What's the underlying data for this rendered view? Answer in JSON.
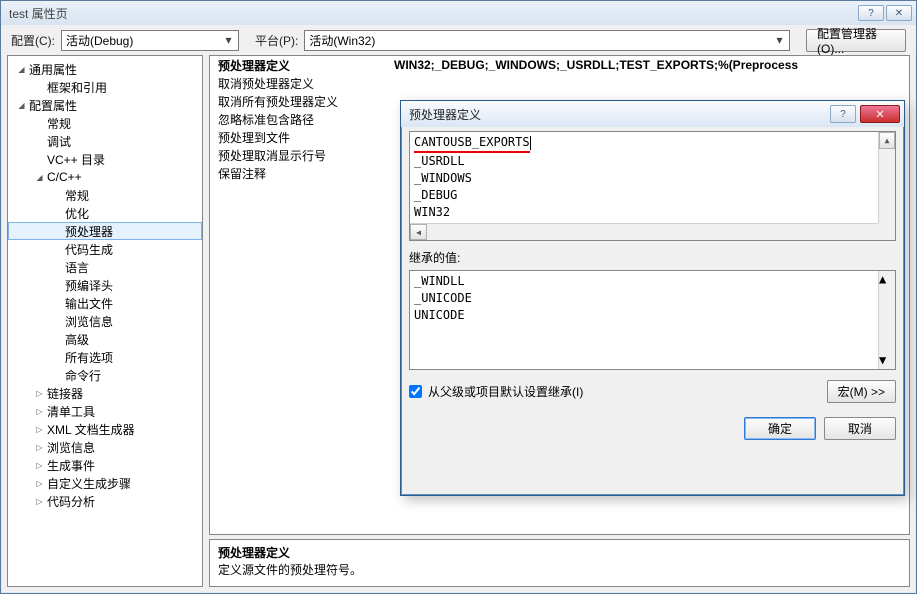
{
  "window": {
    "title": "test 属性页"
  },
  "toolbar": {
    "config_label": "配置(C):",
    "config_value": "活动(Debug)",
    "platform_label": "平台(P):",
    "platform_value": "活动(Win32)",
    "config_mgr_label": "配置管理器(O)..."
  },
  "tree": [
    {
      "indent": 0,
      "twisty": "◢",
      "label": "通用属性"
    },
    {
      "indent": 1,
      "twisty": "",
      "label": "框架和引用"
    },
    {
      "indent": 0,
      "twisty": "◢",
      "label": "配置属性"
    },
    {
      "indent": 1,
      "twisty": "",
      "label": "常规"
    },
    {
      "indent": 1,
      "twisty": "",
      "label": "调试"
    },
    {
      "indent": 1,
      "twisty": "",
      "label": "VC++ 目录"
    },
    {
      "indent": 1,
      "twisty": "◢",
      "label": "C/C++"
    },
    {
      "indent": 2,
      "twisty": "",
      "label": "常规"
    },
    {
      "indent": 2,
      "twisty": "",
      "label": "优化"
    },
    {
      "indent": 2,
      "twisty": "",
      "label": "预处理器",
      "selected": true
    },
    {
      "indent": 2,
      "twisty": "",
      "label": "代码生成"
    },
    {
      "indent": 2,
      "twisty": "",
      "label": "语言"
    },
    {
      "indent": 2,
      "twisty": "",
      "label": "预编译头"
    },
    {
      "indent": 2,
      "twisty": "",
      "label": "输出文件"
    },
    {
      "indent": 2,
      "twisty": "",
      "label": "浏览信息"
    },
    {
      "indent": 2,
      "twisty": "",
      "label": "高级"
    },
    {
      "indent": 2,
      "twisty": "",
      "label": "所有选项"
    },
    {
      "indent": 2,
      "twisty": "",
      "label": "命令行"
    },
    {
      "indent": 1,
      "twisty": "▷",
      "label": "链接器"
    },
    {
      "indent": 1,
      "twisty": "▷",
      "label": "清单工具"
    },
    {
      "indent": 1,
      "twisty": "▷",
      "label": "XML 文档生成器"
    },
    {
      "indent": 1,
      "twisty": "▷",
      "label": "浏览信息"
    },
    {
      "indent": 1,
      "twisty": "▷",
      "label": "生成事件"
    },
    {
      "indent": 1,
      "twisty": "▷",
      "label": "自定义生成步骤"
    },
    {
      "indent": 1,
      "twisty": "▷",
      "label": "代码分析"
    }
  ],
  "props": {
    "rows": [
      {
        "label": "预处理器定义",
        "value": "WIN32;_DEBUG;_WINDOWS;_USRDLL;TEST_EXPORTS;%(Preprocess",
        "bold": true
      },
      {
        "label": "取消预处理器定义",
        "value": ""
      },
      {
        "label": "取消所有预处理器定义",
        "value": ""
      },
      {
        "label": "忽略标准包含路径",
        "value": ""
      },
      {
        "label": "预处理到文件",
        "value": ""
      },
      {
        "label": "预处理取消显示行号",
        "value": ""
      },
      {
        "label": "保留注释",
        "value": ""
      }
    ],
    "desc_title": "预处理器定义",
    "desc_body": "定义源文件的预处理符号。"
  },
  "dialog": {
    "title": "预处理器定义",
    "definitions": [
      "WIN32",
      "_DEBUG",
      "_WINDOWS",
      "_USRDLL",
      "CANTOUSB_EXPORTS"
    ],
    "highlighted_index": 4,
    "inherit_label": "继承的值:",
    "inherited": [
      "_WINDLL",
      "_UNICODE",
      "UNICODE"
    ],
    "inherit_checkbox_label": "从父级或项目默认设置继承(I)",
    "inherit_checked": true,
    "macro_btn": "宏(M) >>",
    "ok": "确定",
    "cancel": "取消"
  }
}
